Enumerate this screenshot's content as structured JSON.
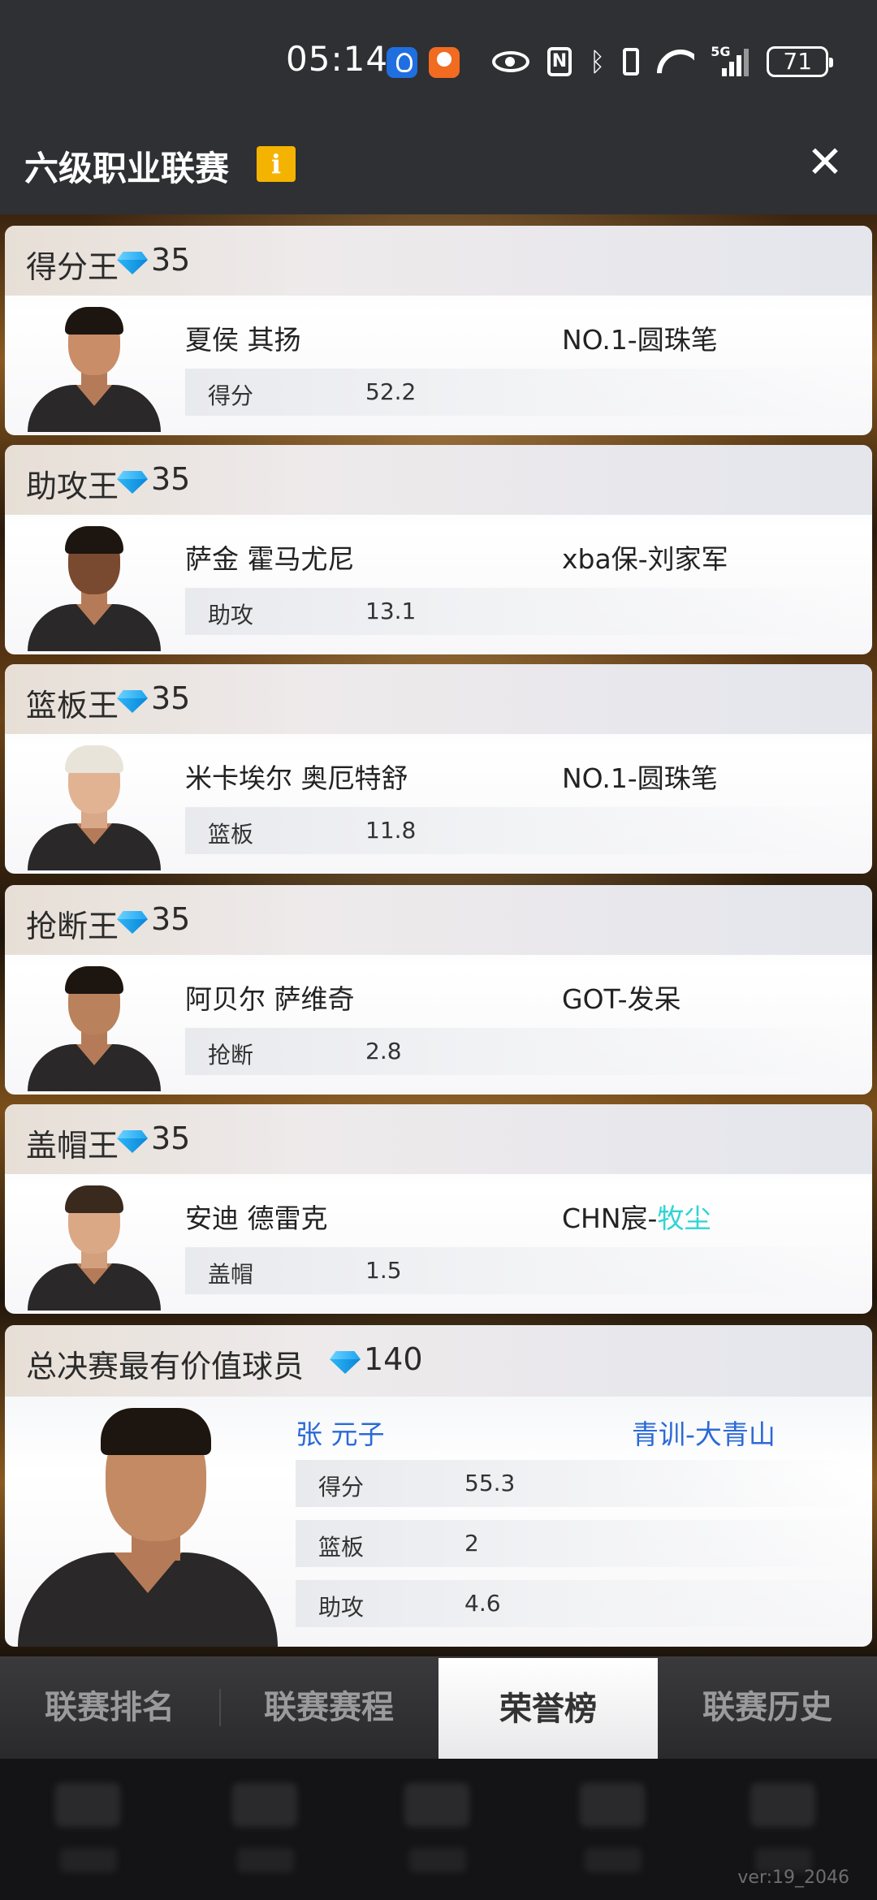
{
  "status_bar": {
    "time": "05:14",
    "network": "5G",
    "battery": "71"
  },
  "header": {
    "title": "六级职业联赛",
    "info_icon": "i",
    "close_icon": "✕"
  },
  "awards": [
    {
      "title": "得分王",
      "gems": "35",
      "player": "夏侯 其扬",
      "team": "NO.1-圆珠笔",
      "stat_label": "得分",
      "stat_value": "52.2"
    },
    {
      "title": "助攻王",
      "gems": "35",
      "player": "萨金 霍马尤尼",
      "team": "xba保-刘家军",
      "stat_label": "助攻",
      "stat_value": "13.1"
    },
    {
      "title": "篮板王",
      "gems": "35",
      "player": "米卡埃尔 奥厄特舒",
      "team": "NO.1-圆珠笔",
      "stat_label": "篮板",
      "stat_value": "11.8"
    },
    {
      "title": "抢断王",
      "gems": "35",
      "player": "阿贝尔 萨维奇",
      "team": "GOT-发呆",
      "stat_label": "抢断",
      "stat_value": "2.8"
    },
    {
      "title": "盖帽王",
      "gems": "35",
      "player": "安迪 德雷克",
      "team_prefix": "CHN宸-",
      "team_highlight": "牧尘",
      "stat_label": "盖帽",
      "stat_value": "1.5"
    }
  ],
  "mvp": {
    "title": "总决赛最有价值球员",
    "gems": "140",
    "player": "张 元子",
    "team": "青训-大青山",
    "stats": [
      {
        "label": "得分",
        "value": "55.3"
      },
      {
        "label": "篮板",
        "value": "2"
      },
      {
        "label": "助攻",
        "value": "4.6"
      }
    ]
  },
  "tabs": [
    {
      "label": "联赛排名"
    },
    {
      "label": "联赛赛程"
    },
    {
      "label": "荣誉榜"
    },
    {
      "label": "联赛历史"
    }
  ],
  "active_tab_index": 2,
  "colors": {
    "highlight_team": "#2fd4d4",
    "mvp_text": "#2a6ad8",
    "info_badge": "#f5b301"
  },
  "version": "ver:19_2046"
}
